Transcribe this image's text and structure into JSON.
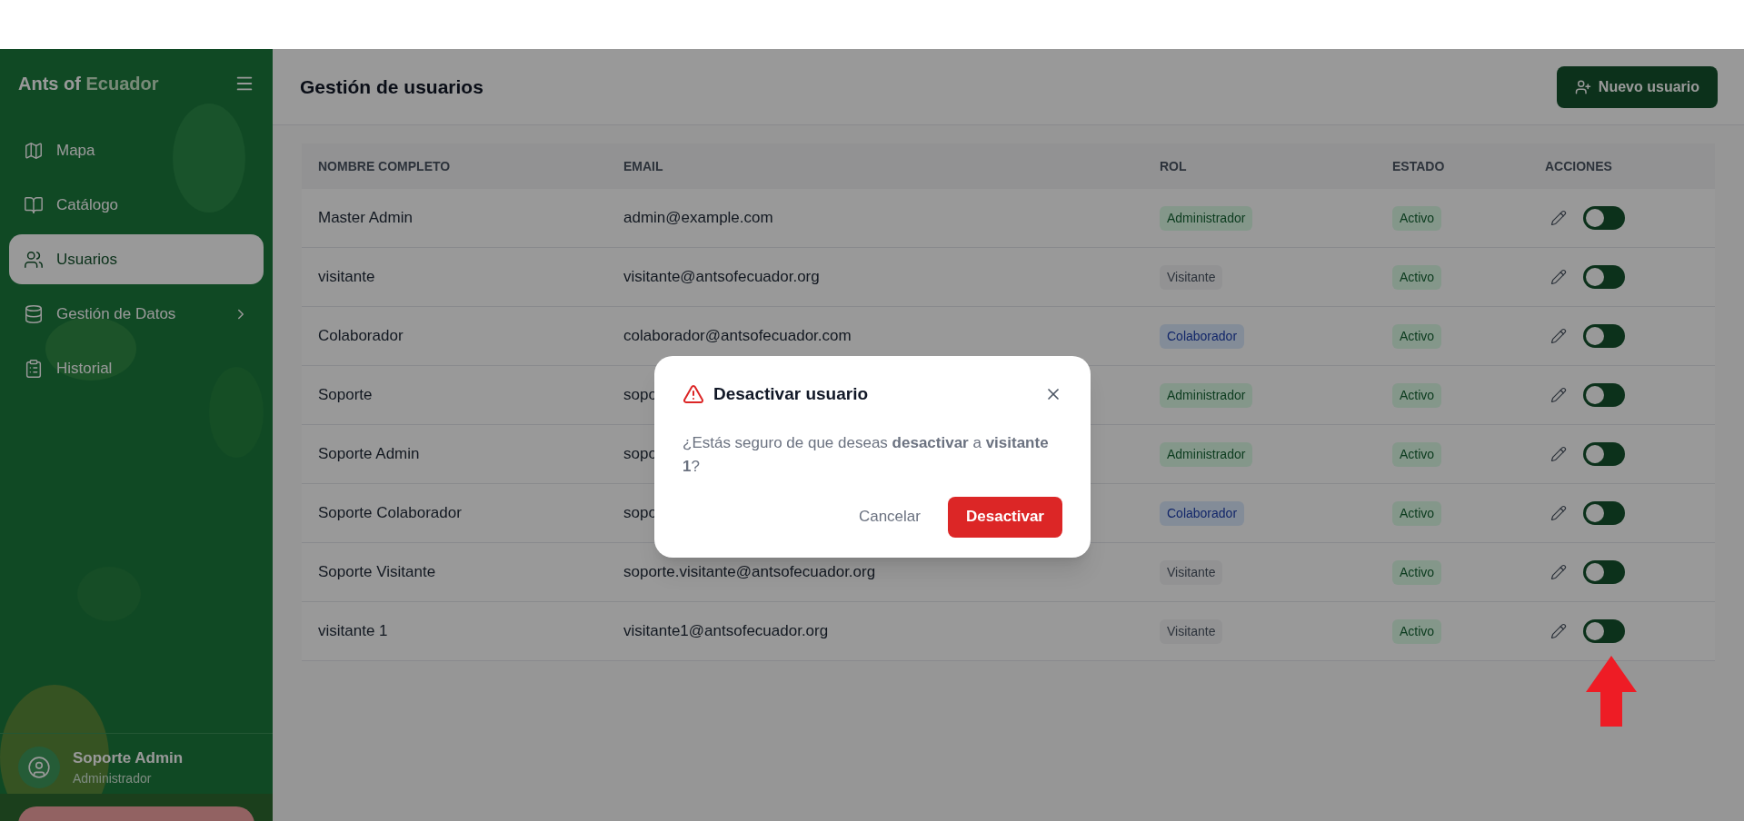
{
  "sidebar": {
    "brand": {
      "first": "Ants of",
      "second": "Ecuador"
    },
    "items": [
      {
        "label": "Mapa",
        "selected": false,
        "has_submenu": false
      },
      {
        "label": "Catálogo",
        "selected": false,
        "has_submenu": false
      },
      {
        "label": "Usuarios",
        "selected": true,
        "has_submenu": false
      },
      {
        "label": "Gestión de Datos",
        "selected": false,
        "has_submenu": true
      },
      {
        "label": "Historial",
        "selected": false,
        "has_submenu": false
      }
    ],
    "user": {
      "name": "Soporte Admin",
      "role": "Administrador"
    }
  },
  "header": {
    "title": "Gestión de usuarios",
    "new_button": "Nuevo usuario"
  },
  "table": {
    "columns": [
      "NOMBRE COMPLETO",
      "EMAIL",
      "ROL",
      "ESTADO",
      "ACCIONES"
    ],
    "rows": [
      {
        "name": "Master Admin",
        "email": "admin@example.com",
        "role": {
          "label": "Administrador",
          "kind": "admin"
        },
        "status": "Activo",
        "on": false
      },
      {
        "name": "visitante",
        "email": "visitante@antsofecuador.org",
        "role": {
          "label": "Visitante",
          "kind": "visitor"
        },
        "status": "Activo",
        "on": false
      },
      {
        "name": "Colaborador",
        "email": "colaborador@antsofecuador.com",
        "role": {
          "label": "Colaborador",
          "kind": "collaborator"
        },
        "status": "Activo",
        "on": false
      },
      {
        "name": "Soporte",
        "email": "sopo",
        "role": {
          "label": "Administrador",
          "kind": "admin"
        },
        "status": "Activo",
        "on": false
      },
      {
        "name": "Soporte Admin",
        "email": "sopo",
        "role": {
          "label": "Administrador",
          "kind": "admin"
        },
        "status": "Activo",
        "on": false
      },
      {
        "name": "Soporte Colaborador",
        "email": "sopo",
        "role": {
          "label": "Colaborador",
          "kind": "collaborator"
        },
        "status": "Activo",
        "on": false
      },
      {
        "name": "Soporte Visitante",
        "email": "soporte.visitante@antsofecuador.org",
        "role": {
          "label": "Visitante",
          "kind": "visitor"
        },
        "status": "Activo",
        "on": false
      },
      {
        "name": "visitante 1",
        "email": "visitante1@antsofecuador.org",
        "role": {
          "label": "Visitante",
          "kind": "visitor"
        },
        "status": "Activo",
        "on": false
      }
    ]
  },
  "dialog": {
    "title": "Desactivar usuario",
    "message": "¿Estás seguro de que deseas **desactivar** a **visitante 1**?",
    "cancel": "Cancelar",
    "confirm": "Desactivar"
  }
}
